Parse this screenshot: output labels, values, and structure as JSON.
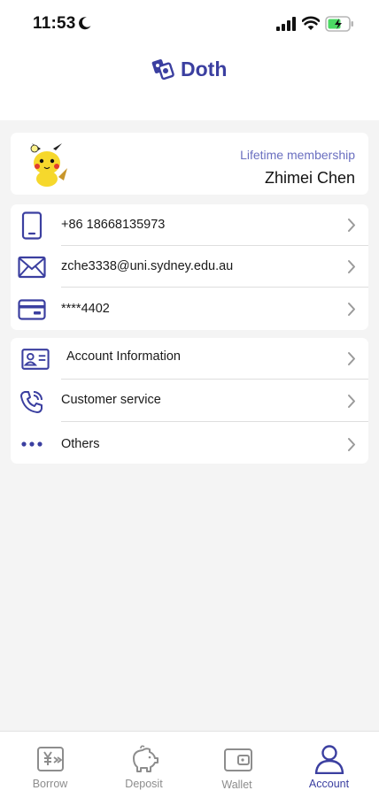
{
  "status_bar": {
    "time": "11:53"
  },
  "header": {
    "brand": "Doth"
  },
  "profile": {
    "membership": "Lifetime membership",
    "name": "Zhimei Chen"
  },
  "contact": [
    {
      "icon": "phone-icon",
      "text": "+86 18668135973"
    },
    {
      "icon": "mail-icon",
      "text": "zche3338@uni.sydney.edu.au"
    },
    {
      "icon": "card-icon",
      "text": "****4402"
    }
  ],
  "menu": [
    {
      "icon": "id-card-icon",
      "text": "Account Information"
    },
    {
      "icon": "phone-call-icon",
      "text": "Customer service"
    },
    {
      "icon": "more-dots-icon",
      "text": "Others"
    }
  ],
  "tabs": [
    {
      "label": "Borrow",
      "icon": "borrow-icon"
    },
    {
      "label": "Deposit",
      "icon": "piggy-bank-icon"
    },
    {
      "label": "Wallet",
      "icon": "wallet-icon"
    },
    {
      "label": "Account",
      "icon": "user-icon",
      "active": true
    }
  ],
  "colors": {
    "accent": "#3b3fa0",
    "muted_accent": "#6a6fc0",
    "tab_inactive": "#8d8d8d",
    "battery": "#4cd964"
  }
}
